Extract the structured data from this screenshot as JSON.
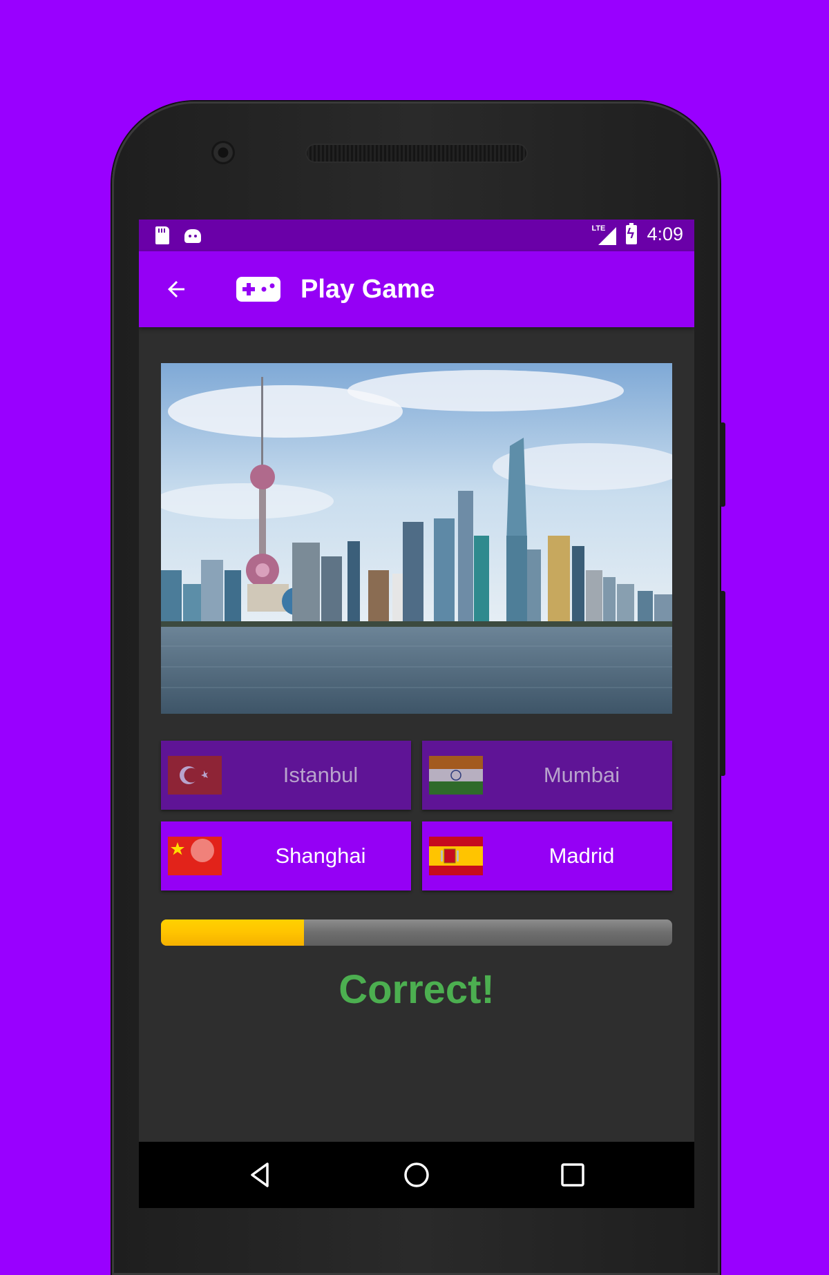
{
  "status_bar": {
    "network": "LTE",
    "time": "4:09",
    "icons": [
      "sd-card-icon",
      "android-icon",
      "lte-signal-icon",
      "battery-charging-icon"
    ]
  },
  "app_bar": {
    "title": "Play Game",
    "back_icon": "arrow-back-icon",
    "title_icon": "gamepad-icon"
  },
  "question": {
    "image": "city-skyline-photo"
  },
  "options": [
    {
      "city": "Istanbul",
      "flag": "turkey-flag-icon",
      "state": "disabled"
    },
    {
      "city": "Mumbai",
      "flag": "india-flag-icon",
      "state": "disabled"
    },
    {
      "city": "Shanghai",
      "flag": "china-flag-icon",
      "state": "enabled"
    },
    {
      "city": "Madrid",
      "flag": "spain-flag-icon",
      "state": "enabled"
    }
  ],
  "progress": {
    "value": 0.28
  },
  "result": {
    "text": "Correct!",
    "color": "#4CAF50"
  },
  "colors": {
    "background": "#9900FF",
    "status_bar": "#6A00A8",
    "app_bar": "#9500F5",
    "option_enabled": "#9500F5",
    "option_disabled": "#5F1496",
    "progress_fill": "#FFC400"
  },
  "nav_bar": {
    "icons": [
      "nav-back-icon",
      "nav-home-icon",
      "nav-recents-icon"
    ]
  }
}
